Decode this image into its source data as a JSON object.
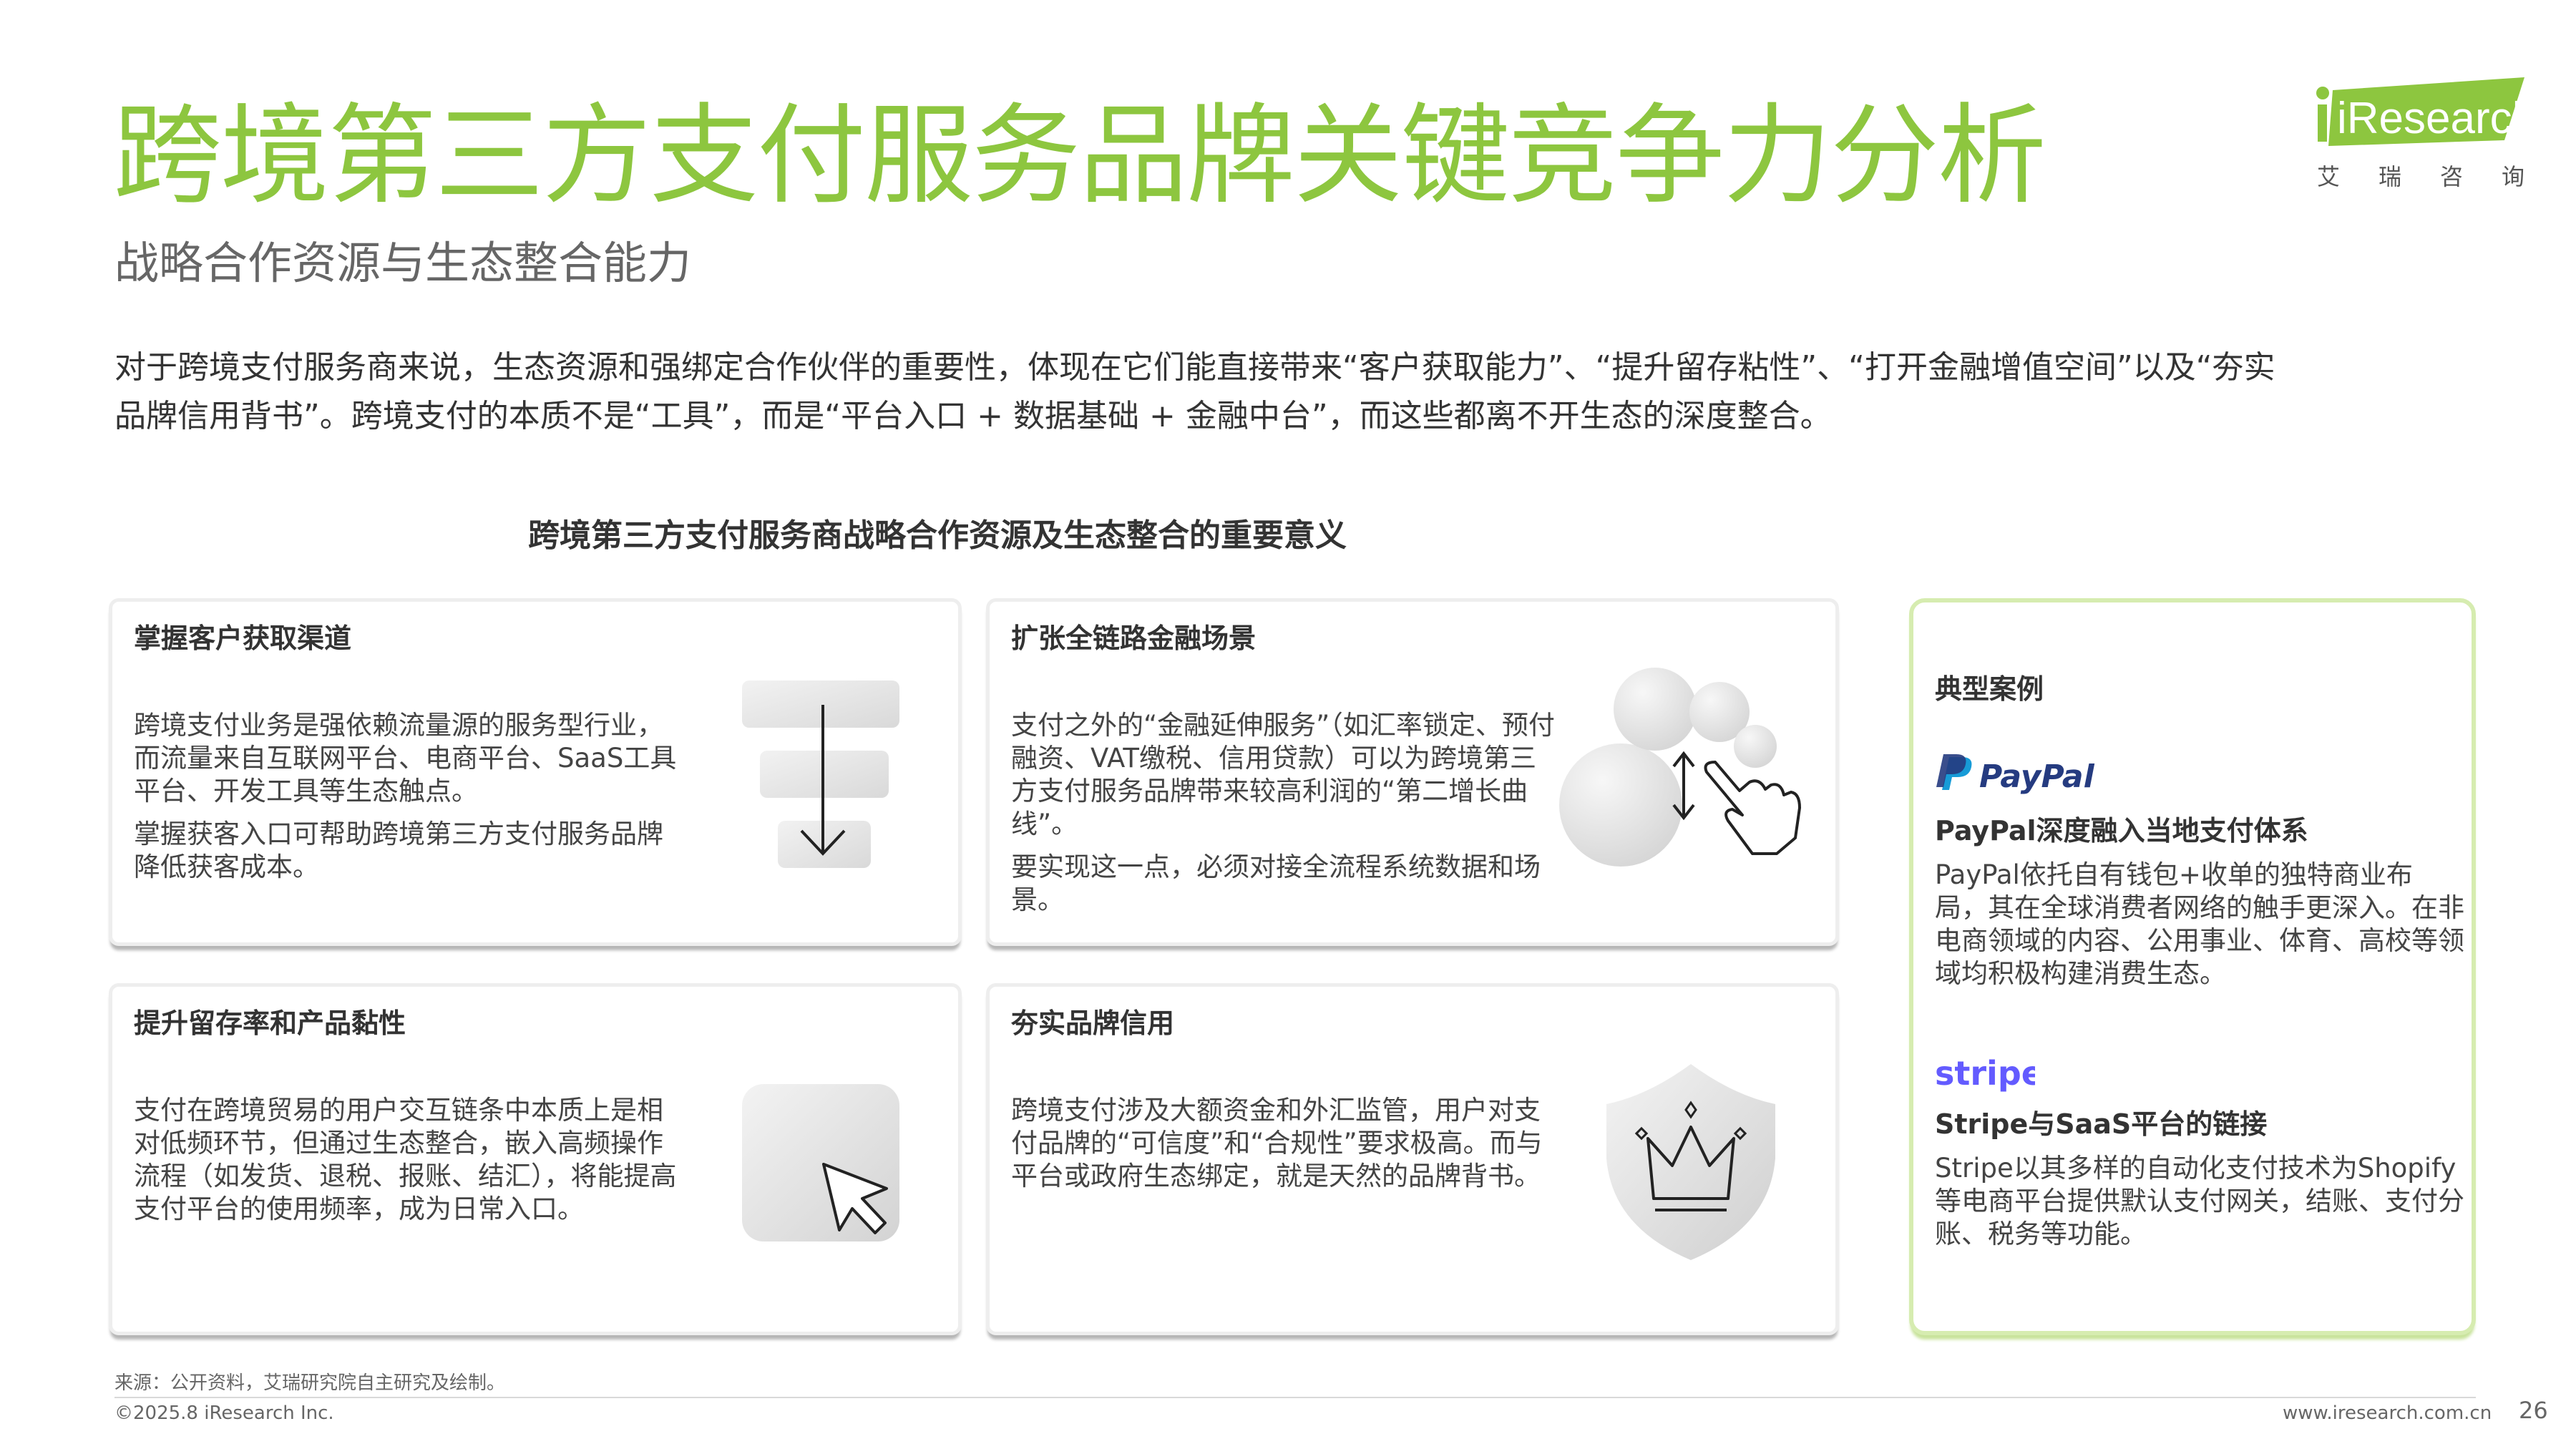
{
  "header": {
    "title": "跨境第三方支付服务品牌关键竞争力分析",
    "subtitle": "战略合作资源与生态整合能力",
    "logo_text": "iResearch",
    "logo_chars": [
      "艾",
      "瑞",
      "咨",
      "询"
    ]
  },
  "intro": {
    "line1": "对于跨境支付服务商来说，生态资源和强绑定合作伙伴的重要性，体现在它们能直接带来“客户获取能力”、“提升留存粘性”、“打开金融增值空间”以及“夯实",
    "line2": "品牌信用背书”。跨境支付的本质不是“工具”，而是“平台入口 + 数据基础 + 金融中台”，而这些都离不开生态的深度整合。"
  },
  "diagram_title": "跨境第三方支付服务商战略合作资源及生态整合的重要意义",
  "cards": [
    {
      "title": "掌握客户获取渠道",
      "paragraphs": [
        "跨境支付业务是强依赖流量源的服务型行业，而流量来自互联网平台、电商平台、SaaS工具平台、开发工具等生态触点。",
        "掌握获客入口可帮助跨境第三方支付服务品牌降低获客成本。"
      ]
    },
    {
      "title": "扩张全链路金融场景",
      "paragraphs": [
        "支付之外的“金融延伸服务”（如汇率锁定、预付融资、VAT缴税、信用贷款）可以为跨境第三方支付服务品牌带来较高利润的“第二增长曲线”。",
        "要实现这一点，必须对接全流程系统数据和场景。"
      ]
    },
    {
      "title": "提升留存率和产品黏性",
      "paragraphs": [
        "支付在跨境贸易的用户交互链条中本质上是相对低频环节，但通过生态整合，嵌入高频操作流程（如发货、退税、报账、结汇），将能提高支付平台的使用频率，成为日常入口。"
      ]
    },
    {
      "title": "夯实品牌信用",
      "paragraphs": [
        "跨境支付涉及大额资金和外汇监管，用户对支付品牌的“可信度”和“合规性”要求极高。而与平台或政府生态绑定，就是天然的品牌背书。"
      ]
    }
  ],
  "cases": {
    "heading": "典型案例",
    "items": [
      {
        "logo": "PayPal",
        "subtitle": "PayPal深度融入当地支付体系",
        "text": "PayPal依托自有钱包+收单的独特商业布局，其在全球消费者网络的触手更深入。在非电商领域的内容、公用事业、体育、高校等领域均积极构建消费生态。"
      },
      {
        "logo": "stripe",
        "subtitle": "Stripe与SaaS平台的链接",
        "text": "Stripe以其多样的自动化支付技术为Shopify等电商平台提供默认支付网关，结账、支付分账、税务等功能。"
      }
    ]
  },
  "footer": {
    "source": "来源：公开资料，艾瑞研究院自主研究及绘制。",
    "copyright": "©2025.8 iResearch Inc.",
    "website": "www.iresearch.com.cn",
    "page": "26"
  },
  "colors": {
    "brand_green": "#8dc63f",
    "paypal_dark": "#253b80",
    "paypal_light": "#179bd7",
    "stripe_purple": "#635bff"
  }
}
